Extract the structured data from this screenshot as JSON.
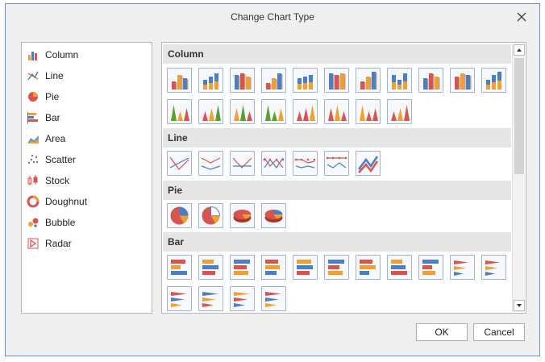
{
  "dialog": {
    "title": "Change Chart Type",
    "ok_label": "OK",
    "cancel_label": "Cancel"
  },
  "chart_types": [
    {
      "label": "Column",
      "icon": "column-chart-icon"
    },
    {
      "label": "Line",
      "icon": "line-chart-icon"
    },
    {
      "label": "Pie",
      "icon": "pie-chart-icon"
    },
    {
      "label": "Bar",
      "icon": "bar-chart-icon"
    },
    {
      "label": "Area",
      "icon": "area-chart-icon"
    },
    {
      "label": "Scatter",
      "icon": "scatter-chart-icon"
    },
    {
      "label": "Stock",
      "icon": "stock-chart-icon"
    },
    {
      "label": "Doughnut",
      "icon": "doughnut-chart-icon"
    },
    {
      "label": "Bubble",
      "icon": "bubble-chart-icon"
    },
    {
      "label": "Radar",
      "icon": "radar-chart-icon"
    }
  ],
  "groups": [
    {
      "title": "Column",
      "kind": "column",
      "variants": 19
    },
    {
      "title": "Line",
      "kind": "line",
      "variants": 7
    },
    {
      "title": "Pie",
      "kind": "pie",
      "variants": 4
    },
    {
      "title": "Bar",
      "kind": "bar",
      "variants": 15
    }
  ],
  "colors": {
    "accent_border": "#6d8fbd",
    "tile_border": "#9fb3cc",
    "series_red": "#d9534f",
    "series_orange": "#f0a030",
    "series_blue": "#4a7fc4",
    "series_green": "#5aa02c",
    "header_bg": "#e6e6e6"
  }
}
